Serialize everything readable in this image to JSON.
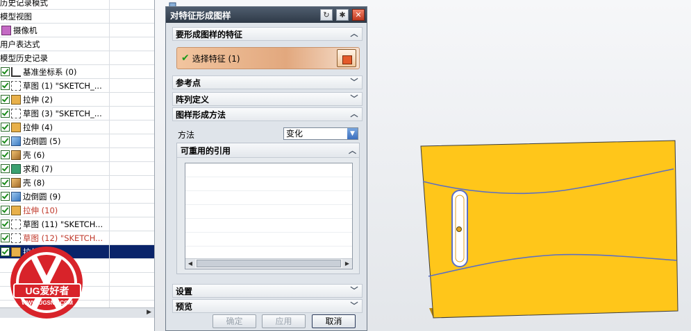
{
  "navigator": {
    "rows": [
      {
        "label": "历史记录模式",
        "check": false,
        "icon": "none-icon",
        "red": false,
        "selected": false
      },
      {
        "label": "模型视图",
        "check": false,
        "icon": "none-icon",
        "red": false,
        "selected": false
      },
      {
        "label": "摄像机",
        "check": false,
        "icon": "camera-icon",
        "red": false,
        "selected": false
      },
      {
        "label": "用户表达式",
        "check": false,
        "icon": "none-icon",
        "red": false,
        "selected": false
      },
      {
        "label": "模型历史记录",
        "check": false,
        "icon": "none-icon",
        "red": false,
        "selected": false
      },
      {
        "label": "基准坐标系 (0)",
        "check": true,
        "icon": "datum-csys-icon",
        "red": false,
        "selected": false
      },
      {
        "label": "草图 (1) \"SKETCH_...",
        "check": true,
        "icon": "sketch-icon",
        "red": false,
        "selected": false
      },
      {
        "label": "拉伸 (2)",
        "check": true,
        "icon": "extrude-icon",
        "red": false,
        "selected": false
      },
      {
        "label": "草图 (3) \"SKETCH_...",
        "check": true,
        "icon": "sketch-icon",
        "red": false,
        "selected": false
      },
      {
        "label": "拉伸 (4)",
        "check": true,
        "icon": "extrude-icon",
        "red": false,
        "selected": false
      },
      {
        "label": "边倒圆 (5)",
        "check": true,
        "icon": "edge-blend-icon",
        "red": false,
        "selected": false
      },
      {
        "label": "壳 (6)",
        "check": true,
        "icon": "shell-icon",
        "red": false,
        "selected": false
      },
      {
        "label": "求和 (7)",
        "check": true,
        "icon": "unite-icon",
        "red": false,
        "selected": false
      },
      {
        "label": "壳 (8)",
        "check": true,
        "icon": "shell-icon",
        "red": false,
        "selected": false
      },
      {
        "label": "边倒圆 (9)",
        "check": true,
        "icon": "edge-blend-icon",
        "red": false,
        "selected": false
      },
      {
        "label": "拉伸 (10)",
        "check": true,
        "icon": "extrude-icon",
        "red": true,
        "selected": false
      },
      {
        "label": "草图 (11) \"SKETCH...",
        "check": true,
        "icon": "sketch-icon",
        "red": false,
        "selected": false
      },
      {
        "label": "草图 (12) \"SKETCH...",
        "check": true,
        "icon": "sketch-icon",
        "red": true,
        "selected": false
      },
      {
        "label": "拉伸 (13)",
        "check": true,
        "icon": "extrude-icon",
        "red": false,
        "selected": true
      }
    ]
  },
  "watermark": {
    "brand": "UG爱好者",
    "url": "WWW.UGSNX.COM"
  },
  "dialog": {
    "title": "对特征形成图样",
    "sections": {
      "features": "要形成图样的特征",
      "select_feature": "选择特征 (1)",
      "reference_point": "参考点",
      "array_definition": "阵列定义",
      "pattern_method": "图样形成方法",
      "method_label": "方法",
      "method_value": "变化",
      "reusable_refs": "可重用的引用",
      "settings": "设置",
      "preview": "预览"
    },
    "buttons": {
      "ok": "确定",
      "apply": "应用",
      "cancel": "取消"
    }
  },
  "colors": {
    "part_face": "#FFC61A",
    "curve": "#5b6fc4",
    "selected_row": "#0a246a"
  }
}
